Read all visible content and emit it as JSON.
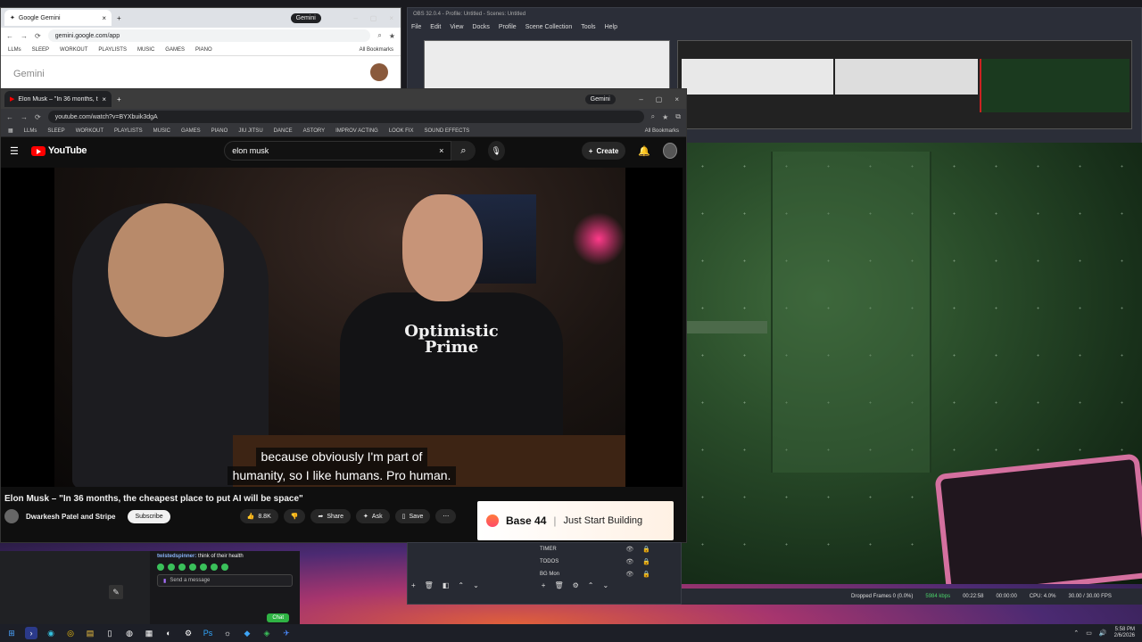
{
  "gemini_window": {
    "tab_title": "Google Gemini",
    "url": "gemini.google.com/app",
    "tab_pill": "Gemini",
    "page_heading": "Gemini",
    "bookmarks": [
      "LLMs",
      "SLEEP",
      "WORKOUT",
      "PLAYLISTS",
      "MUSIC",
      "GAMES",
      "PIANO"
    ],
    "all_bookmarks": "All Bookmarks"
  },
  "obs_window": {
    "title": "OBS 32.0.4 - Profile: Untitled - Scenes: Untitled",
    "menu": [
      "File",
      "Edit",
      "View",
      "Docks",
      "Profile",
      "Scene Collection",
      "Tools",
      "Help"
    ],
    "sources": [
      {
        "label": "TIMER"
      },
      {
        "label": "TODOS"
      },
      {
        "label": "BG Mon"
      }
    ],
    "status": {
      "dropped": "Dropped Frames 0 (0.0%)",
      "bitrate": "5984 kbps",
      "live_time": "00:22:58",
      "rec_time": "00:00:00",
      "cpu": "CPU: 4.0%",
      "fps": "30.00 / 30.00 FPS"
    }
  },
  "youtube_window": {
    "tab_title": "Elon Musk – \"In 36 months, th",
    "url": "youtube.com/watch?v=BYXbuik3dgA",
    "tab_pill": "Gemini",
    "bookmarks": [
      "LLMs",
      "SLEEP",
      "WORKOUT",
      "PLAYLISTS",
      "MUSIC",
      "GAMES",
      "PIANO",
      "JIU JITSU",
      "DANCE",
      "ASTORY",
      "IMPROV ACTING",
      "LOOK FIX",
      "SOUND EFFECTS"
    ],
    "all_bookmarks": "All Bookmarks",
    "logo_text": "YouTube",
    "search_value": "elon musk",
    "create_label": "Create",
    "captions": [
      "because obviously I'm part of",
      "humanity, so I like humans. Pro human."
    ],
    "shirt_text": "Optimistic Prime",
    "video_title": "Elon Musk – \"In 36 months, the cheapest place to put AI will be space\"",
    "channel_name": "Dwarkesh Patel and Stripe",
    "subscribe_label": "Subscribe",
    "like_count": "8.8K",
    "share_label": "Share",
    "ask_label": "Ask",
    "save_label": "Save",
    "ad": {
      "brand": "Base 44",
      "tagline": "Just Start Building"
    }
  },
  "chat_window": {
    "message_user": "twistedspinner:",
    "message_text": "think of their health",
    "input_placeholder": "Send a message",
    "chat_button": "Chat"
  },
  "taskbar": {
    "time": "5:58 PM",
    "date": "2/6/2026"
  }
}
